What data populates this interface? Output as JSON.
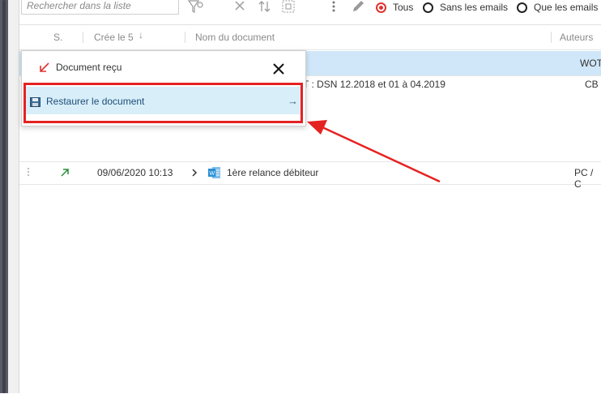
{
  "toolbar": {
    "search_placeholder": "Rechercher dans la liste",
    "filter_options": [
      {
        "label": "Tous",
        "selected": true
      },
      {
        "label": "Sans les emails",
        "selected": false
      },
      {
        "label": "Que les emails",
        "selected": false
      }
    ],
    "icons": [
      "filter-icon",
      "clear-icon",
      "sort-icon",
      "select-all-icon",
      "more-icon",
      "edit-icon"
    ]
  },
  "table": {
    "headers": {
      "status": "S.",
      "created": "Crée le 5",
      "created_sort": "↓",
      "document_name": "Nom du document",
      "authors": "Auteurs"
    },
    "rows": [
      {
        "authors": "WOT"
      },
      {
        "name": "T : DSN 12.2018 et 01 à 04.2019",
        "authors": "CB"
      },
      {
        "date": "09/06/2020 10:13",
        "name": "1ère relance débiteur",
        "authors": "PC / C"
      }
    ]
  },
  "popup": {
    "title": "Document reçu",
    "item_label": "Restaurer le document",
    "item_arrow": "→"
  },
  "colors": {
    "selected_row": "#cfe7f8",
    "accent_red": "#e52222",
    "word_blue": "#2b8fd6"
  }
}
